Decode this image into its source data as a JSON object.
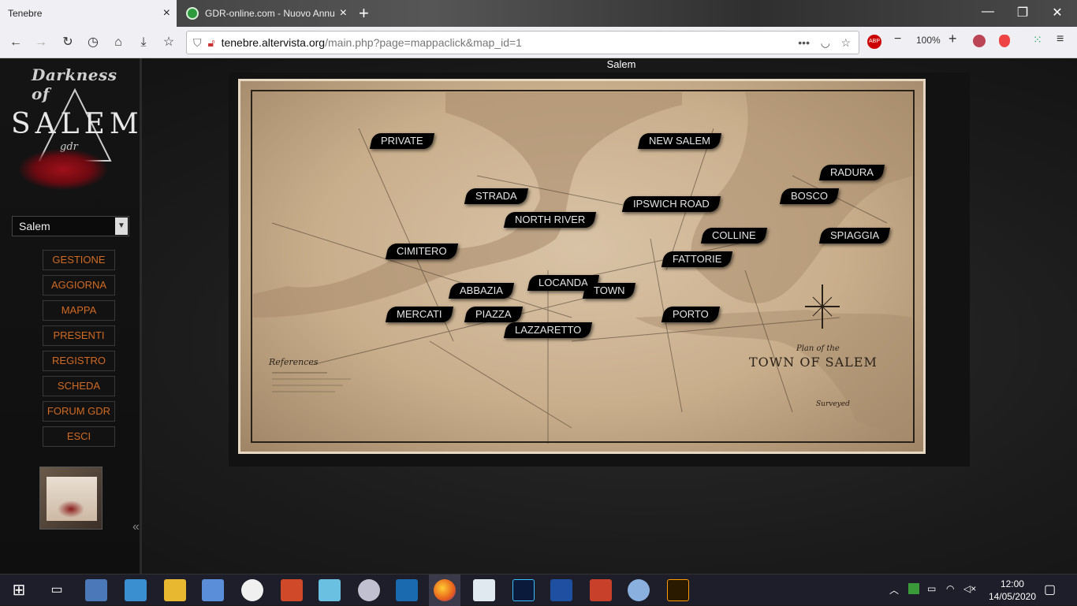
{
  "browser": {
    "tabs": [
      {
        "title": "Tenebre"
      },
      {
        "title": "GDR-online.com - Nuovo Annu"
      }
    ],
    "url_host": "tenebre.altervista.org",
    "url_path": "/main.php?page=mappaclick&map_id=1",
    "zoom": "100%",
    "new_tab": "+",
    "minimize": "—",
    "restore": "❐",
    "close": "✕",
    "tab_close": "×",
    "ext_abp": "ABP"
  },
  "sidebar": {
    "logo": {
      "line1": "Darkness of",
      "line2": "SALEM",
      "line3": "gdr"
    },
    "location_select": "Salem",
    "menu": [
      {
        "label": "GESTIONE"
      },
      {
        "label": "AGGIORNA"
      },
      {
        "label": "MAPPA"
      },
      {
        "label": "PRESENTI"
      },
      {
        "label": "REGISTRO"
      },
      {
        "label": "SCHEDA"
      },
      {
        "label": "FORUM GDR"
      },
      {
        "label": "ESCI"
      }
    ]
  },
  "map": {
    "title": "Salem",
    "map_heading": "Plan of the",
    "map_title": "TOWN OF SALEM",
    "map_references": "References",
    "map_surveyed": "Surveyed",
    "locations": [
      {
        "label": "PRIVATE"
      },
      {
        "label": "NEW SALEM"
      },
      {
        "label": "RADURA"
      },
      {
        "label": "STRADA"
      },
      {
        "label": "BOSCO"
      },
      {
        "label": "IPSWICH ROAD"
      },
      {
        "label": "NORTH RIVER"
      },
      {
        "label": "COLLINE"
      },
      {
        "label": "SPIAGGIA"
      },
      {
        "label": "CIMITERO"
      },
      {
        "label": "FATTORIE"
      },
      {
        "label": "LOCANDA"
      },
      {
        "label": "ABBAZIA"
      },
      {
        "label": "TOWN"
      },
      {
        "label": "MERCATI"
      },
      {
        "label": "PIAZZA"
      },
      {
        "label": "PORTO"
      },
      {
        "label": "LAZZARETTO"
      }
    ]
  },
  "taskbar": {
    "time": "12:00",
    "date": "14/05/2020"
  },
  "colors": {
    "menu_text": "#d16a22",
    "label_bg": "#000000",
    "map_parchment": "#c9ae8c"
  }
}
